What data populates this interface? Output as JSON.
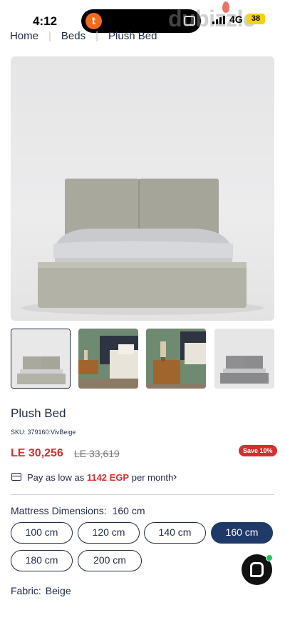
{
  "status_bar": {
    "time": "4:12",
    "app_badge": "t",
    "network": "4G",
    "battery": "38",
    "watermark": "dubizzle"
  },
  "breadcrumb": [
    "Home",
    "Beds",
    "Plush Bed"
  ],
  "product": {
    "title": "Plush Bed",
    "sku": "SKU: 379160:VivBeige",
    "price": "LE 30,256",
    "old_price": "LE 33,619",
    "save_badge": "Save 10%"
  },
  "installment": {
    "prefix": "Pay as low as",
    "amount": "1142 EGP",
    "suffix": "per month"
  },
  "mattress": {
    "label": "Mattress Dimensions:",
    "selected": "160 cm",
    "options": [
      "100 cm",
      "120 cm",
      "140 cm",
      "160 cm",
      "180 cm",
      "200 cm"
    ]
  },
  "fabric": {
    "label": "Fabric:",
    "value": "Beige"
  },
  "colors": {
    "accent_red": "#d32f2f",
    "navy": "#1f2a44",
    "selected_button": "#1f3a68",
    "online_dot": "#22c55e"
  }
}
